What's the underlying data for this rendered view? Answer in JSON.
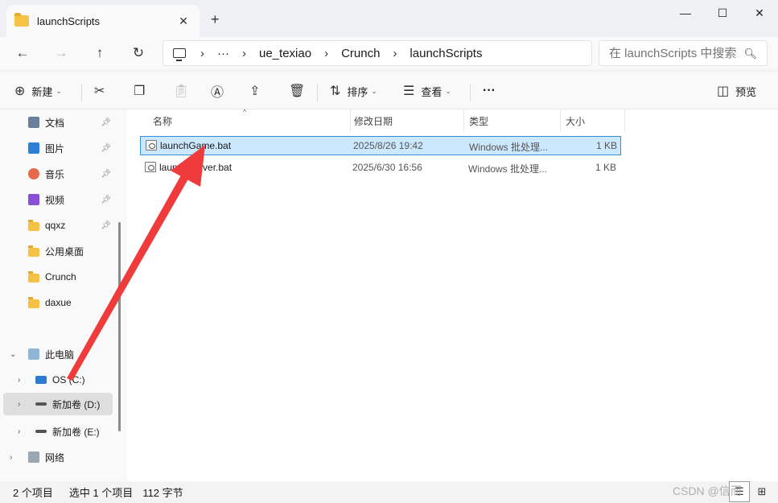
{
  "window": {
    "tab_title": "launchScripts",
    "tab_close": "✕",
    "new_tab": "+",
    "minimize": "—",
    "maximize": "☐",
    "close": "✕"
  },
  "nav": {
    "back": "←",
    "forward": "→",
    "up": "↑",
    "refresh": "↻",
    "breadcrumb_overflow": "···",
    "breadcrumb": [
      "ue_texiao",
      "Crunch",
      "launchScripts"
    ],
    "breadcrumb_sep": "›",
    "search_placeholder": "在 launchScripts 中搜索"
  },
  "toolbar": {
    "new_label": "新建",
    "sort_label": "排序",
    "view_label": "查看",
    "more_label": "···",
    "preview_label": "预览"
  },
  "sidebar": {
    "quick_access": [
      {
        "label": "文档",
        "icon": "document-icon",
        "color": "#6a7f9c",
        "pinned": true
      },
      {
        "label": "图片",
        "icon": "pictures-icon",
        "color": "#2e7fd6",
        "pinned": true
      },
      {
        "label": "音乐",
        "icon": "music-icon",
        "color": "#e46a4b",
        "pinned": true
      },
      {
        "label": "视频",
        "icon": "videos-icon",
        "color": "#8a4fd6",
        "pinned": true
      },
      {
        "label": "qqxz",
        "icon": "folder-icon",
        "color": "#f5c244",
        "pinned": true
      },
      {
        "label": "公用桌面",
        "icon": "folder-icon",
        "color": "#f5c244",
        "pinned": false
      },
      {
        "label": "Crunch",
        "icon": "folder-icon",
        "color": "#f5c244",
        "pinned": false
      },
      {
        "label": "daxue",
        "icon": "folder-icon",
        "color": "#f5c244",
        "pinned": false
      }
    ],
    "this_pc": "此电脑",
    "drives": [
      {
        "label": "OS (C:)",
        "icon": "windows-drive-icon",
        "selected": false
      },
      {
        "label": "新加卷 (D:)",
        "icon": "drive-icon",
        "selected": true
      },
      {
        "label": "新加卷 (E:)",
        "icon": "drive-icon",
        "selected": false
      }
    ],
    "network": "网络"
  },
  "list": {
    "columns": {
      "name": "名称",
      "modified": "修改日期",
      "type": "类型",
      "size": "大小"
    },
    "files": [
      {
        "name": "launchGame.bat",
        "modified": "2025/8/26 19:42",
        "type": "Windows 批处理...",
        "size": "1 KB",
        "selected": true
      },
      {
        "name": "launchServer.bat",
        "modified": "2025/6/30 16:56",
        "type": "Windows 批处理...",
        "size": "1 KB",
        "selected": false
      }
    ]
  },
  "status": {
    "item_count": "2 个项目",
    "selection": "选中 1 个项目",
    "selection_size": "112 字节"
  },
  "watermark": "CSDN @信而",
  "colors": {
    "selection_bg": "#cce8ff",
    "selection_border": "#3c8cd6",
    "arrow": "#ef3b3b"
  }
}
